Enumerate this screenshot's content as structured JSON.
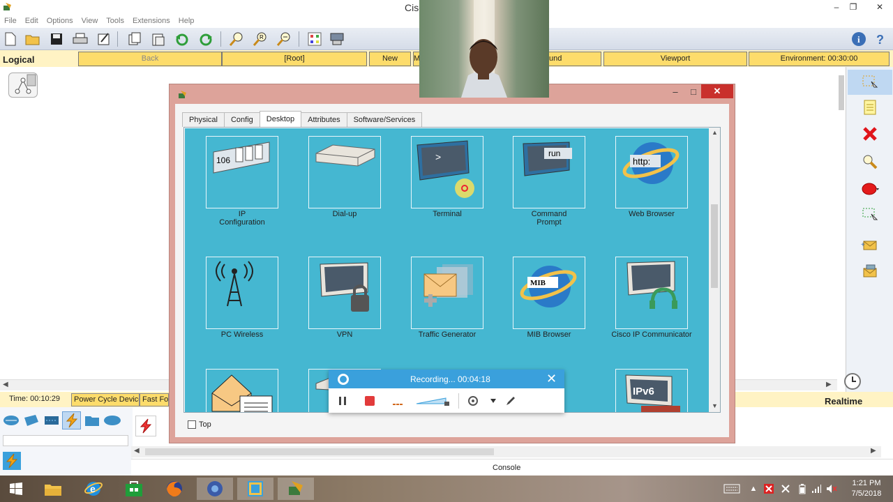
{
  "window": {
    "title": "Cisc"
  },
  "menu": [
    "File",
    "Edit",
    "Options",
    "View",
    "Tools",
    "Extensions",
    "Help"
  ],
  "nav": {
    "logical": "Logical",
    "back": "Back",
    "root": "[Root]",
    "new_cluster": "New Cluster",
    "truncated1": "M",
    "background": "und",
    "viewport": "Viewport",
    "environment": "Environment: 00:30:00"
  },
  "status": {
    "time": "Time: 00:10:29",
    "power_cycle": "Power Cycle Devices",
    "fast_forward": "Fast Forw",
    "realtime": "Realtime"
  },
  "console": {
    "label": "Console"
  },
  "dialog": {
    "tabs": [
      "Physical",
      "Config",
      "Desktop",
      "Attributes",
      "Software/Services"
    ],
    "active_tab": "Desktop",
    "top_checkbox": "Top",
    "apps": [
      {
        "label": "IP\nConfiguration",
        "icon": "ip-configuration-icon",
        "badge": "106"
      },
      {
        "label": "Dial-up",
        "icon": "dial-up-icon"
      },
      {
        "label": "Terminal",
        "icon": "terminal-icon",
        "badge": ">"
      },
      {
        "label": "Command\nPrompt",
        "icon": "command-prompt-icon",
        "badge": "run"
      },
      {
        "label": "Web Browser",
        "icon": "web-browser-icon",
        "badge": "http:"
      },
      {
        "label": "PC Wireless",
        "icon": "pc-wireless-icon"
      },
      {
        "label": "VPN",
        "icon": "vpn-icon"
      },
      {
        "label": "Traffic Generator",
        "icon": "traffic-generator-icon"
      },
      {
        "label": "MIB Browser",
        "icon": "mib-browser-icon",
        "badge": "MIB"
      },
      {
        "label": "Cisco IP Communicator",
        "icon": "ip-communicator-icon"
      },
      {
        "label": "",
        "icon": "email-icon"
      },
      {
        "label": "",
        "icon": "pppoe-dialer-icon"
      },
      {
        "label": "",
        "icon": "ipv6-firewall-icon",
        "badge": "IPv6"
      }
    ]
  },
  "recording": {
    "text": "Recording... 00:04:18"
  },
  "taskbar": {
    "time": "1:21 PM",
    "date": "7/5/2018"
  },
  "colors": {
    "desktop_bg": "#45b7d1",
    "dialog_frame": "#dda39a",
    "nav_yellow": "#fddc6b",
    "record_blue": "#3aa0dc"
  }
}
